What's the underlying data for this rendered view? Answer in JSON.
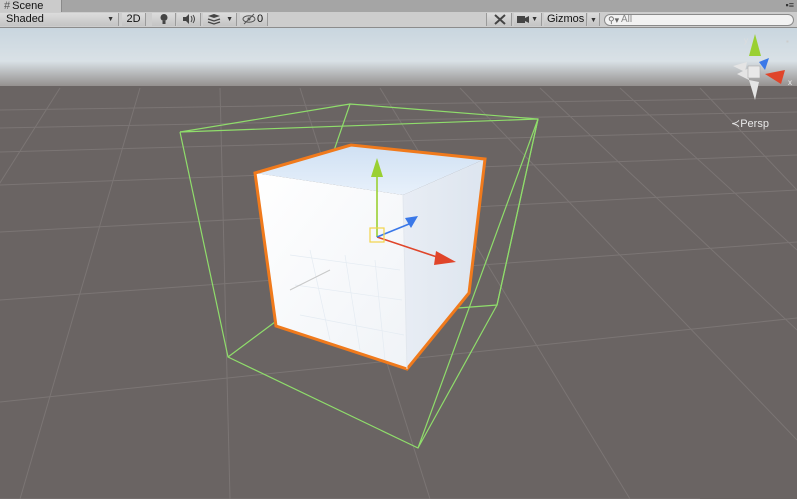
{
  "tab": {
    "icon": "hash-icon",
    "label": "Scene",
    "menu_icon": "menu-icon"
  },
  "toolbar": {
    "draw_mode": "Shaded",
    "mode_2d": "2D",
    "lighting_icon": "lightbulb-icon",
    "audio_icon": "audio-icon",
    "effects_icon": "effects-icon",
    "hidden_icon": "eye-slash-icon",
    "hidden_count": "0",
    "tools_icon": "tools-icon",
    "camera_icon": "camera-icon",
    "gizmos_label": "Gizmos",
    "search_placeholder": "All",
    "search_icon": "search-icon"
  },
  "view": {
    "projection_label": "Persp"
  },
  "colors": {
    "ground": "#6a6463",
    "sky_top": "#c9d7e0",
    "selection_outline": "#f07a1c",
    "bounds": "#8fdd6b",
    "axis_x": "#e0452a",
    "axis_y": "#9ad032",
    "axis_z": "#3a78e8"
  }
}
